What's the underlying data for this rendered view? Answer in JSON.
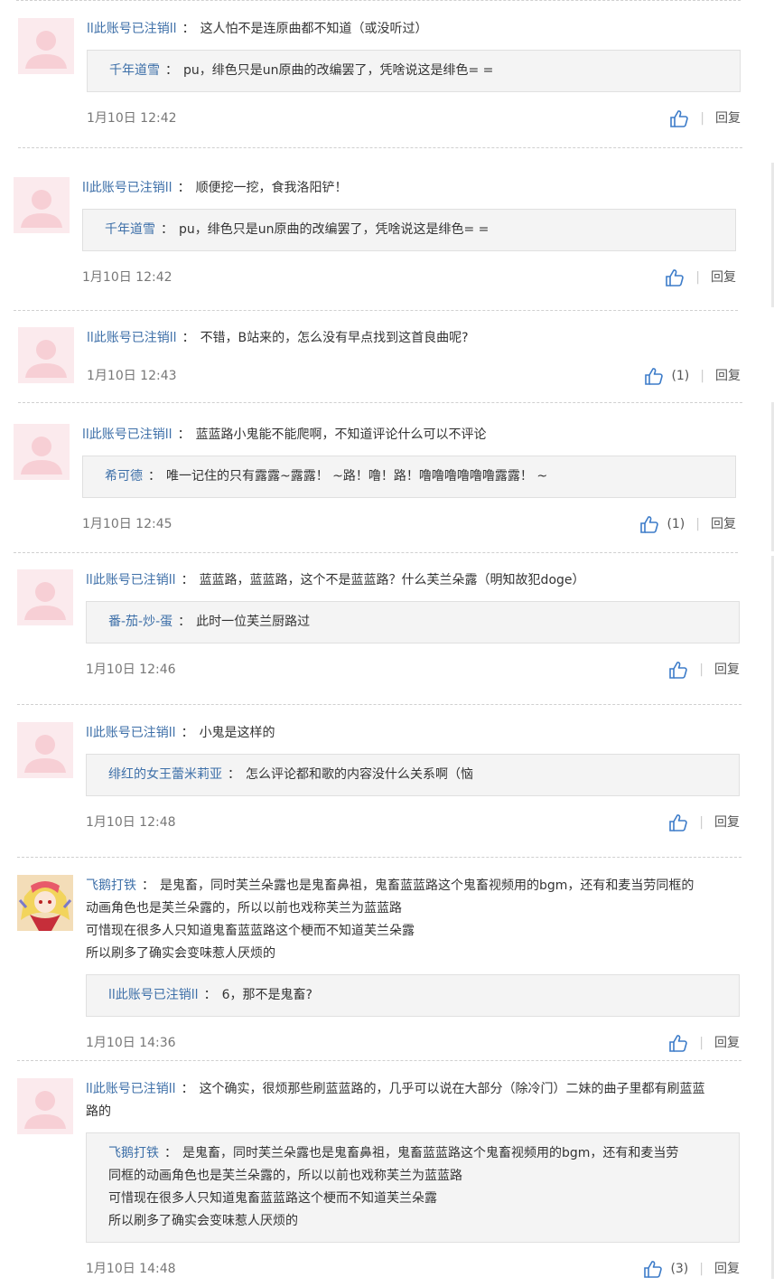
{
  "reply_label": "回复",
  "sep": "：",
  "comments": [
    {
      "user": "ll此账号已注销ll",
      "text": "这人怕不是连原曲都不知道（或没听过）",
      "quote": {
        "user": "千年道雪",
        "lines": [
          "pu，绯色只是un原曲的改编罢了，凭啥说这是绯色= ="
        ]
      },
      "time": "1月10日 12:42",
      "likes": ""
    },
    {
      "user": "ll此账号已注销ll",
      "text": "顺便挖一挖，食我洛阳铲！",
      "quote": {
        "user": "千年道雪",
        "lines": [
          "pu，绯色只是un原曲的改编罢了，凭啥说这是绯色= ="
        ]
      },
      "time": "1月10日 12:42",
      "likes": ""
    },
    {
      "user": "ll此账号已注销ll",
      "text": "不错，B站来的，怎么没有早点找到这首良曲呢?",
      "quote": null,
      "time": "1月10日 12:43",
      "likes": "(1)"
    },
    {
      "user": "ll此账号已注销ll",
      "text": "蓝蓝路小鬼能不能爬啊，不知道评论什么可以不评论",
      "quote": {
        "user": "希可德",
        "lines": [
          "唯一记住的只有露露~露露！ ~路！噜！路！噜噜噜噜噜噜露露！ ~"
        ]
      },
      "time": "1月10日 12:45",
      "likes": "(1)"
    },
    {
      "user": "ll此账号已注销ll",
      "text": "蓝蓝路，蓝蓝路，这个不是蓝蓝路？什么芙兰朵露（明知故犯doge）",
      "quote": {
        "user": "番-茄-炒-蛋",
        "lines": [
          "此时一位芙兰厨路过"
        ]
      },
      "time": "1月10日 12:46",
      "likes": ""
    },
    {
      "user": "ll此账号已注销ll",
      "text": "小鬼是这样的",
      "quote": {
        "user": "绯红的女王蕾米莉亚",
        "lines": [
          "怎么评论都和歌的内容没什么关系啊（恼"
        ]
      },
      "time": "1月10日 12:48",
      "likes": ""
    },
    {
      "user": "飞鹅打铁",
      "text_lines": [
        "是鬼畜，同时芙兰朵露也是鬼畜鼻祖，鬼畜蓝蓝路这个鬼畜视频用的bgm，还有和麦当劳同框的",
        "动画角色也是芙兰朵露的，所以以前也戏称芙兰为蓝蓝路",
        "可惜现在很多人只知道鬼畜蓝蓝路这个梗而不知道芙兰朵露",
        "所以刷多了确实会变味惹人厌烦的"
      ],
      "quote": {
        "user": "ll此账号已注销ll",
        "lines": [
          "6，那不是鬼畜?"
        ]
      },
      "time": "1月10日 14:36",
      "likes": ""
    },
    {
      "user": "ll此账号已注销ll",
      "text_lines": [
        "这个确实，很烦那些刷蓝蓝路的，几乎可以说在大部分（除冷门）二妹的曲子里都有刷蓝蓝",
        "路的"
      ],
      "quote": {
        "user": "飞鹅打铁",
        "lines": [
          "是鬼畜，同时芙兰朵露也是鬼畜鼻祖，鬼畜蓝蓝路这个鬼畜视频用的bgm，还有和麦当劳",
          "同框的动画角色也是芙兰朵露的，所以以前也戏称芙兰为蓝蓝路",
          "可惜现在很多人只知道鬼畜蓝蓝路这个梗而不知道芙兰朵露",
          "所以刷多了确实会变味惹人厌烦的"
        ]
      },
      "time": "1月10日 14:48",
      "likes": "(3)"
    }
  ]
}
